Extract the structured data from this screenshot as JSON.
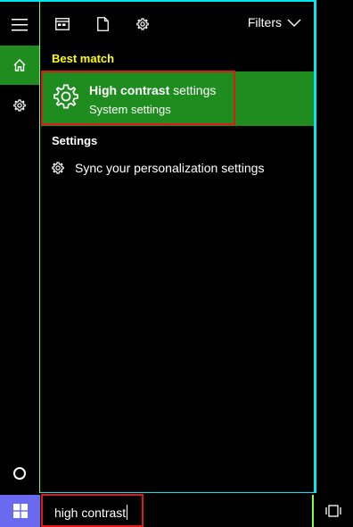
{
  "toolbar": {
    "filters_label": "Filters",
    "icons": [
      "apps-icon",
      "documents-icon",
      "settings-icon"
    ]
  },
  "rail": {
    "icons": [
      "hamburger-icon",
      "home-icon",
      "gear-icon",
      "cortana-circle-icon"
    ]
  },
  "results": {
    "best_match_header": "Best match",
    "best_match": {
      "title_bold": "High contrast",
      "title_rest": " settings",
      "subtitle": "System settings",
      "icon": "gear-icon"
    },
    "settings_header": "Settings",
    "settings_items": [
      {
        "label": "Sync your personalization settings",
        "icon": "gear-icon"
      }
    ]
  },
  "taskbar": {
    "search_value": "high contrast",
    "start_icon": "windows-logo-icon",
    "taskview_icon": "task-view-icon"
  },
  "colors": {
    "accent_green": "#1e8c1e",
    "section_yellow": "#ffff00",
    "border_cyan": "#00e5ee",
    "border_lime": "#7fff3a",
    "highlight_red": "#e01818",
    "start_blue": "#6a6af0"
  }
}
